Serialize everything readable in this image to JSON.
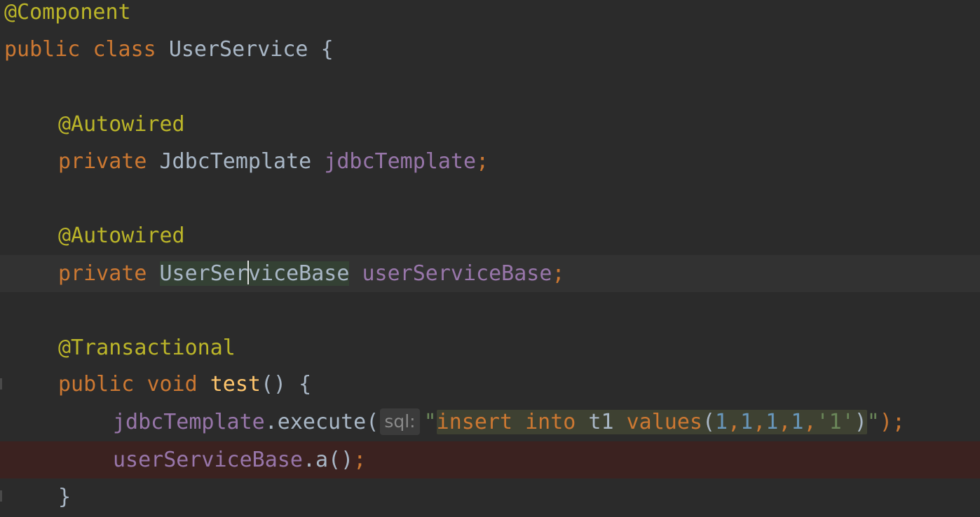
{
  "code": {
    "line1": {
      "annotation": "@Component"
    },
    "line2": {
      "kw_public": "public",
      "kw_class": "class",
      "class_name": "UserService",
      "brace": "{"
    },
    "line4": {
      "annotation": "@Autowired"
    },
    "line5": {
      "kw_private": "private",
      "type": "JdbcTemplate",
      "field": "jdbcTemplate",
      "semi": ";"
    },
    "line7": {
      "annotation": "@Autowired"
    },
    "line8": {
      "kw_private": "private",
      "type_before_caret": "UserSer",
      "type_after_caret": "viceBase",
      "field": "userServiceBase",
      "semi": ";"
    },
    "line10": {
      "annotation": "@Transactional"
    },
    "line11": {
      "kw_public": "public",
      "kw_void": "void",
      "method": "test",
      "parens_brace": "() {"
    },
    "line12": {
      "receiver": "jdbcTemplate",
      "call": ".execute(",
      "param_hint": "sql:",
      "quote_open": "\"",
      "sql_insert": "insert",
      "sql_into": "into",
      "sql_table": "t1",
      "sql_values": "values",
      "sql_paren_open": "(",
      "v1": "1",
      "v2": "1",
      "v3": "1",
      "v4": "1",
      "v5": "'1'",
      "comma": ",",
      "sql_paren_close": ")",
      "quote_close": "\"",
      "end": ");"
    },
    "line13": {
      "receiver": "userServiceBase",
      "call": ".a()",
      "semi": ";"
    },
    "line14": {
      "brace": "}"
    }
  }
}
